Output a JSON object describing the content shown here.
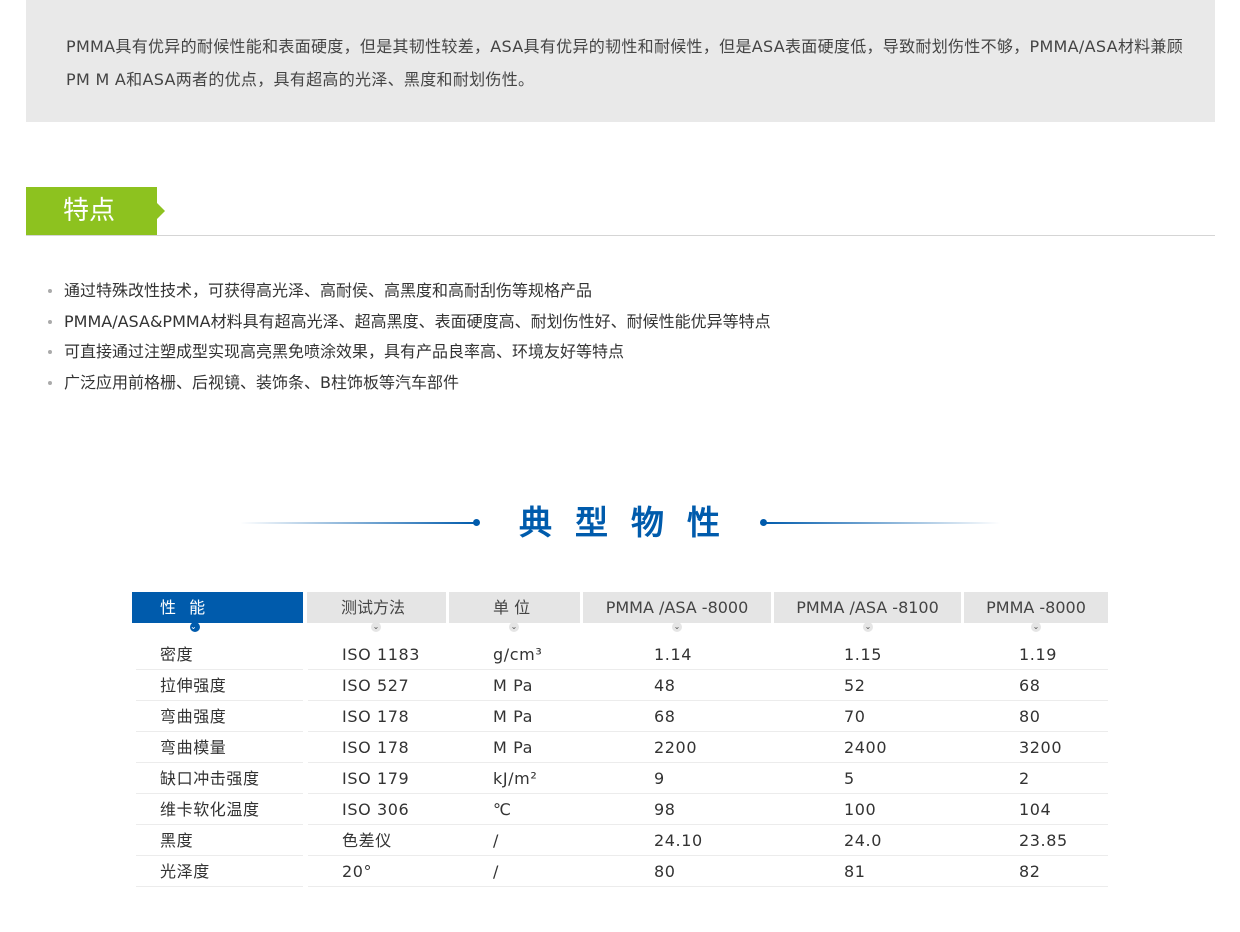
{
  "intro": {
    "text": "PMMA具有优异的耐候性能和表面硬度，但是其韧性较差，ASA具有优异的韧性和耐候性，但是ASA表面硬度低，导致耐划伤性不够，PMMA/ASA材料兼顾PM M A和ASA两者的优点，具有超高的光泽、黑度和耐划伤性。"
  },
  "features_section": {
    "title": "特点",
    "items": [
      "通过特殊改性技术，可获得高光泽、高耐侯、高黑度和高耐刮伤等规格产品",
      "PMMA/ASA&PMMA材料具有超高光泽、超高黑度、表面硬度高、耐划伤性好、耐候性能优异等特点",
      "可直接通过注塑成型实现高亮黑免喷涂效果，具有产品良率高、环境友好等特点",
      "广泛应用前格栅、后视镜、装饰条、B柱饰板等汽车部件"
    ]
  },
  "properties_section": {
    "title": "典型物性",
    "table": {
      "headers": [
        "性 能",
        "测试方法",
        "单 位",
        "PMMA /ASA -8000",
        "PMMA /ASA -8100",
        "PMMA -8000"
      ],
      "rows": [
        [
          "密度",
          "ISO 1183",
          "g/cm³",
          "1.14",
          "1.15",
          "1.19"
        ],
        [
          "拉伸强度",
          "ISO 527",
          "M Pa",
          "48",
          "52",
          "68"
        ],
        [
          "弯曲强度",
          "ISO 178",
          "M Pa",
          "68",
          "70",
          "80"
        ],
        [
          "弯曲模量",
          "ISO 178",
          "M Pa",
          "2200",
          "2400",
          "3200"
        ],
        [
          "缺口冲击强度",
          "ISO 179",
          "kJ/m²",
          "9",
          "5",
          "2"
        ],
        [
          "维卡软化温度",
          "ISO 306",
          "℃",
          "98",
          "100",
          "104"
        ],
        [
          "黑度",
          "色差仪",
          "/",
          "24.10",
          "24.0",
          "23.85"
        ],
        [
          "光泽度",
          "20°",
          "/",
          "80",
          "81",
          "82"
        ]
      ]
    }
  },
  "colors": {
    "brand_blue": "#005bac",
    "accent_green": "#8dc21f",
    "intro_bg": "#e9e9e9",
    "header_gray": "#e5e5e5"
  },
  "icons": {
    "header_chevron": "chevron-down-icon",
    "bullet": "bullet-dot-icon"
  }
}
